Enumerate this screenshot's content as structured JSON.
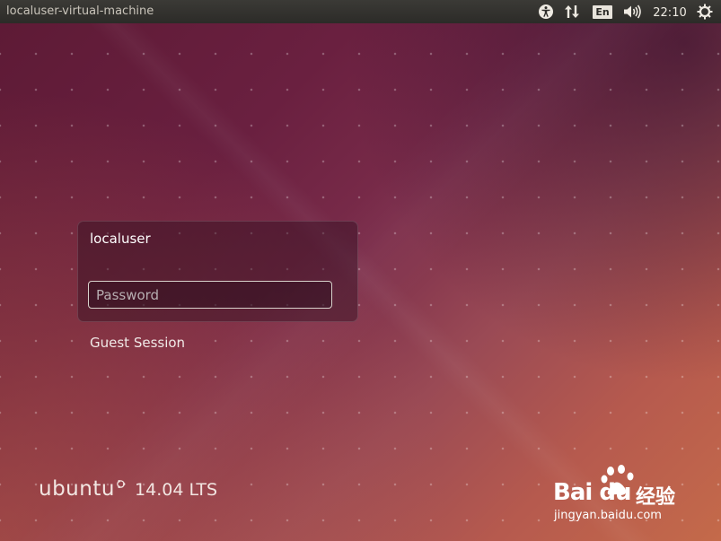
{
  "panel": {
    "hostname": "localuser-virtual-machine",
    "keyboard_layout": "En",
    "clock": "22:10",
    "icons": [
      "accessibility-icon",
      "network-icon",
      "sound-icon",
      "power-icon"
    ]
  },
  "login": {
    "user_name": "localuser",
    "password_placeholder": "Password",
    "password_value": "",
    "guest_session_label": "Guest Session"
  },
  "branding": {
    "os_name": "ubuntu",
    "version": "14.04 LTS"
  },
  "watermark": {
    "brand": "Bai du",
    "brand_cn": "经验",
    "url": "jingyan.baidu.com"
  },
  "colors": {
    "panel_bg": "#2c2b28",
    "bg_top": "#5d1a35",
    "bg_bottom": "#c46a4a",
    "text_light": "#ffffff"
  }
}
